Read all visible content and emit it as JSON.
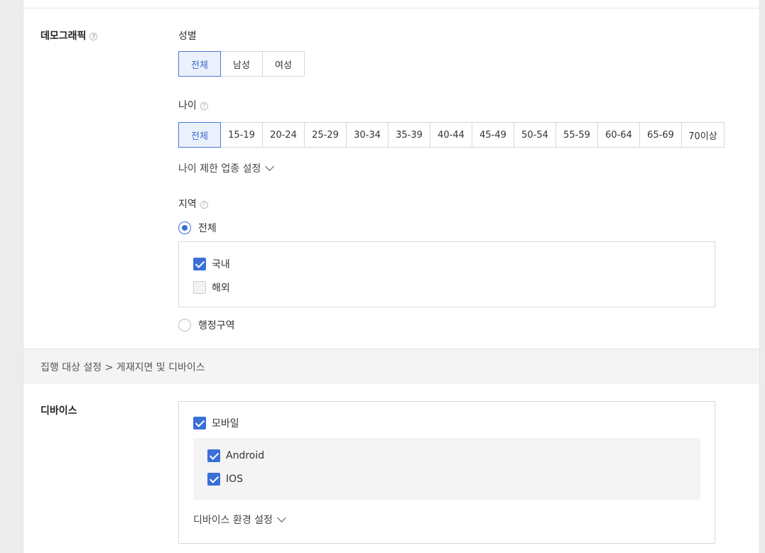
{
  "demographic": {
    "label": "데모그래픽",
    "gender": {
      "label": "성별",
      "options": [
        "전체",
        "남성",
        "여성"
      ],
      "selected": "전체"
    },
    "age": {
      "label": "나이",
      "options": [
        "전체",
        "15-19",
        "20-24",
        "25-29",
        "30-34",
        "35-39",
        "40-44",
        "45-49",
        "50-54",
        "55-59",
        "60-64",
        "65-69",
        "70이상"
      ],
      "selected": "전체",
      "restrict_toggle": "나이 제한 업종 설정"
    },
    "region": {
      "label": "지역",
      "all_label": "전체",
      "domestic_label": "국내",
      "overseas_label": "해외",
      "admin_label": "행정구역"
    }
  },
  "section_band": {
    "title": "집행 대상 설정 > 게재지면 및 디바이스"
  },
  "device": {
    "label": "디바이스",
    "mobile_label": "모바일",
    "android_label": "Android",
    "ios_label": "IOS",
    "env_toggle": "디바이스 환경 설정"
  },
  "help_glyph": "?",
  "colors": {
    "accent": "#3a6fd8",
    "active_bg": "#eaf1fd",
    "border": "#d6d6d6",
    "band_bg": "#f4f4f4"
  }
}
